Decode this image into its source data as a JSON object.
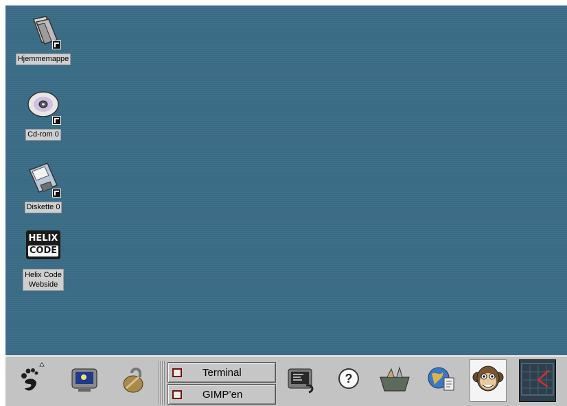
{
  "desktop": {
    "background_color": "#3a6b85",
    "icons": [
      {
        "label": "Hjemmemappe",
        "icon": "home-folder-icon"
      },
      {
        "label": "Cd-rom 0",
        "icon": "cdrom-icon"
      },
      {
        "label": "Diskette 0",
        "icon": "floppy-icon"
      },
      {
        "label_lines": [
          "Helix Code",
          "Webside"
        ],
        "icon": "helix-code-logo",
        "logo_text": [
          "HELIX",
          "CODE"
        ]
      }
    ]
  },
  "panel": {
    "launchers": [
      {
        "icon": "gnome-foot-menu-icon"
      },
      {
        "icon": "monitor-icon"
      },
      {
        "icon": "padlock-icon"
      },
      {
        "icon": "terminal-launcher-icon"
      },
      {
        "icon": "help-icon"
      },
      {
        "icon": "toolbox-icon"
      },
      {
        "icon": "globe-document-icon"
      },
      {
        "icon": "monkey-face-icon"
      },
      {
        "icon": "clock-icon"
      }
    ],
    "tasks": [
      {
        "label": "Terminal"
      },
      {
        "label": "GIMP’en"
      }
    ]
  }
}
